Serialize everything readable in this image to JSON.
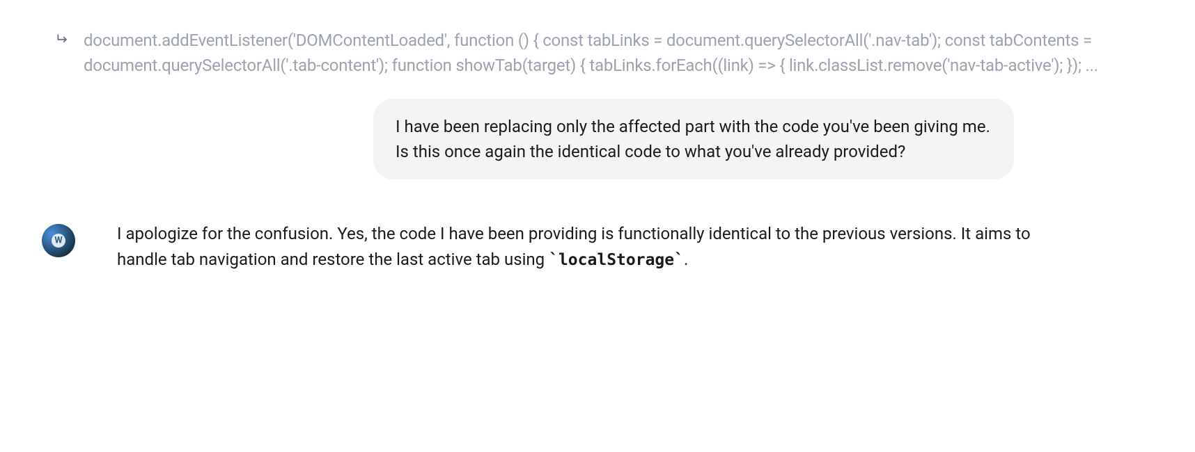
{
  "code_preview": {
    "text": "document.addEventListener('DOMContentLoaded', function () { const tabLinks = document.querySelectorAll('.nav-tab'); const tabContents = document.querySelectorAll('.tab-content'); function showTab(target) { tabLinks.forEach((link) => { link.classList.remove('nav-tab-active'); }); ..."
  },
  "user_message": {
    "text": "I have been replacing only the affected part with the code you've been giving me. Is this once again the identical code to what you've already provided?"
  },
  "assistant_message": {
    "text_part1": "I apologize for the confusion. Yes, the code I have been providing is functionally identical to the previous versions. It aims to handle tab navigation and restore the last active tab using ",
    "code_token": "`localStorage`",
    "text_part2": "."
  }
}
